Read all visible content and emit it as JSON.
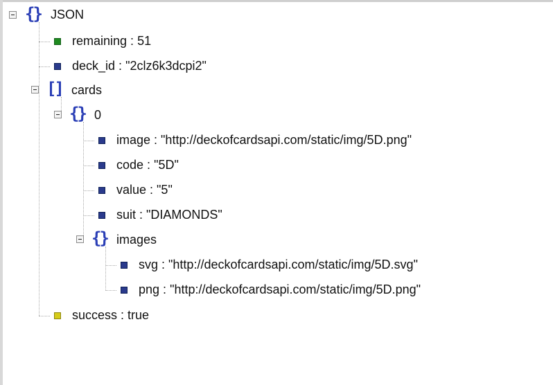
{
  "tree": {
    "root": {
      "label": "JSON"
    },
    "remaining": {
      "key": "remaining",
      "value": "51",
      "icon_color": "#1f8a1f"
    },
    "deck_id": {
      "key": "deck_id",
      "value": "\"2clz6k3dcpi2\"",
      "icon_color": "#2a3a8c"
    },
    "cards": {
      "label": "cards",
      "item0": {
        "label": "0",
        "image": {
          "key": "image",
          "value": "\"http://deckofcardsapi.com/static/img/5D.png\""
        },
        "code": {
          "key": "code",
          "value": "\"5D\""
        },
        "value": {
          "key": "value",
          "value": "\"5\""
        },
        "suit": {
          "key": "suit",
          "value": "\"DIAMONDS\""
        },
        "images": {
          "label": "images",
          "svg": {
            "key": "svg",
            "value": "\"http://deckofcardsapi.com/static/img/5D.svg\""
          },
          "png": {
            "key": "png",
            "value": "\"http://deckofcardsapi.com/static/img/5D.png\""
          }
        }
      }
    },
    "success": {
      "key": "success",
      "value": "true",
      "icon_color": "#d6cc1a"
    }
  }
}
